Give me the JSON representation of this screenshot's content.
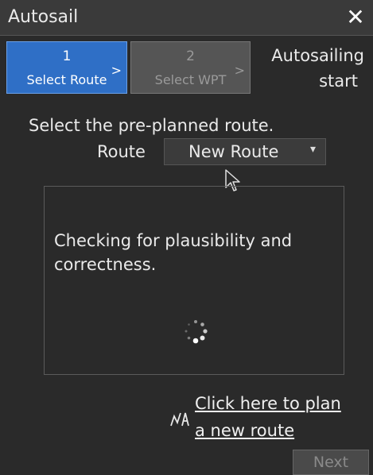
{
  "window": {
    "title": "Autosail",
    "close_label": "✕"
  },
  "steps": [
    {
      "number": "1",
      "label": "Select Route",
      "arrow": ">",
      "state": "active"
    },
    {
      "number": "2",
      "label": "Select WPT",
      "arrow": ">",
      "state": "disabled"
    },
    {
      "label_line1": "Autosailing",
      "label_line2": "start"
    }
  ],
  "main": {
    "instruction": "Select the pre-planned route.",
    "route_label": "Route",
    "route_value": "New Route",
    "route_caret": "▾"
  },
  "status": {
    "line1": "Checking for plausibility and",
    "line2": "correctness."
  },
  "plan_link": {
    "line1": "Click here to plan",
    "line2": "a new route",
    "icon": "plan-route-icon"
  },
  "footer": {
    "next_label": "Next"
  },
  "colors": {
    "accent": "#2f6fc6",
    "background": "#2a2a2a"
  }
}
